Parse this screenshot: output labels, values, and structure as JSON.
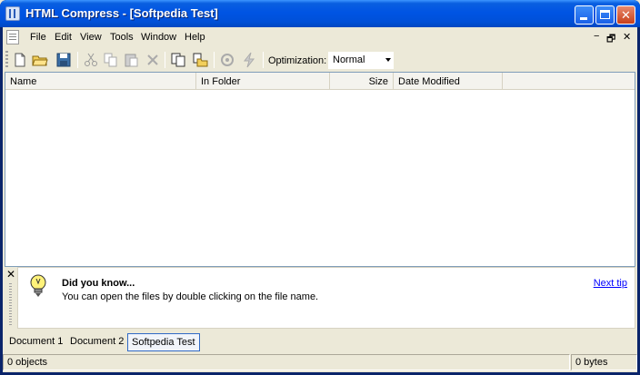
{
  "window": {
    "title": "HTML Compress - [Softpedia Test]",
    "colors": {
      "titlebar": "#0054E3",
      "face": "#ECE9D8",
      "link": "#0000FF"
    }
  },
  "menu": {
    "items": [
      "File",
      "Edit",
      "View",
      "Tools",
      "Window",
      "Help"
    ],
    "mdi_controls": [
      "−",
      "🗗",
      "✕"
    ]
  },
  "toolbar": {
    "icons": [
      "new-icon",
      "open-icon",
      "save-icon",
      "cut-icon",
      "copy-icon",
      "paste-icon",
      "delete-icon",
      "copy-files-icon",
      "copy-folder-icon",
      "compress-icon",
      "quick-compress-icon"
    ],
    "optimization_label": "Optimization:",
    "optimization_value": "Normal"
  },
  "list": {
    "columns": [
      "Name",
      "In Folder",
      "Size",
      "Date Modified"
    ]
  },
  "tip": {
    "close": "✕",
    "title": "Did you know...",
    "text": "You can open the files by double clicking on the file name.",
    "next_link": "Next tip"
  },
  "documents": {
    "tabs": [
      "Document 1",
      "Document 2",
      "Softpedia Test"
    ],
    "active_index": 2
  },
  "status": {
    "objects": "0 objects",
    "bytes": "0 bytes"
  }
}
